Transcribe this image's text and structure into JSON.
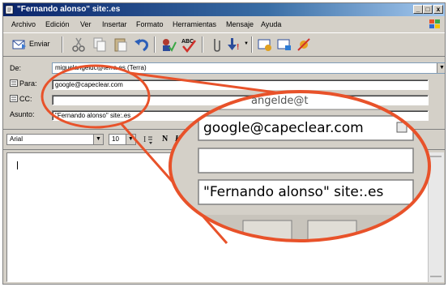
{
  "window": {
    "title": "\"Fernando alonso\" site:.es",
    "buttons": {
      "minimize": "_",
      "maximize": "□",
      "close": "x"
    }
  },
  "menu": {
    "items": [
      {
        "label": "Archivo"
      },
      {
        "label": "Edición"
      },
      {
        "label": "Ver"
      },
      {
        "label": "Insertar"
      },
      {
        "label": "Formato"
      },
      {
        "label": "Herramientas"
      },
      {
        "label": "Mensaje"
      },
      {
        "label": "Ayuda"
      }
    ]
  },
  "toolbar": {
    "send_label": "Enviar",
    "icons": [
      "send-icon",
      "cut-icon",
      "copy-icon",
      "paste-icon",
      "undo-icon",
      "check-names-icon",
      "spelling-icon",
      "attach-icon",
      "priority-icon",
      "sign-icon",
      "encrypt-icon",
      "offline-icon"
    ],
    "spell_text": "ABC"
  },
  "header": {
    "from_label": "De:",
    "from_value": "miguelangeldc@terra.es   (Terra)",
    "to_label": "Para:",
    "to_value": "google@capeclear.com",
    "cc_label": "CC:",
    "cc_value": "",
    "subject_label": "Asunto:",
    "subject_value": "\"Fernando alonso\" site:.es"
  },
  "format": {
    "font": "Arial",
    "size": "10",
    "bold": "N",
    "italic": "K"
  },
  "zoom": {
    "top_partial": "angelde@t",
    "to_value": "google@capeclear.com",
    "cc_value": "",
    "subject_value": "\"Fernando alonso\" site:.es"
  },
  "colors": {
    "accent": "#e8522a",
    "title_start": "#0a246a",
    "title_end": "#a6caf0",
    "chrome": "#d4d0c8"
  }
}
